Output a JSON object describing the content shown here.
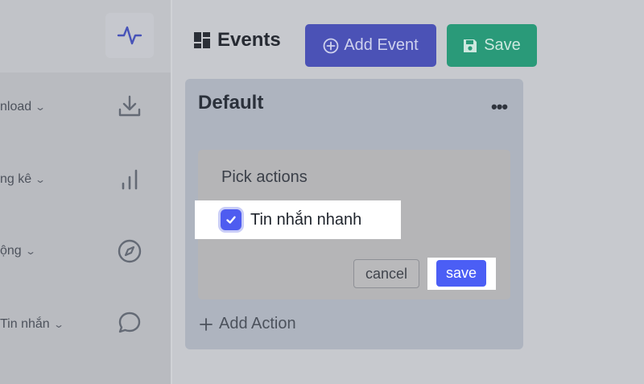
{
  "sidebar": {
    "items": [
      {
        "label": "nload",
        "icon": "download-icon"
      },
      {
        "label": "ng kê",
        "icon": "bar-chart-icon"
      },
      {
        "label": "ộng",
        "icon": "compass-icon"
      },
      {
        "label": "Tin nhắn",
        "icon": "message-icon"
      }
    ],
    "top_icon": "activity-icon"
  },
  "header": {
    "title": "Events",
    "add_event_label": "Add Event",
    "save_label": "Save"
  },
  "event_card": {
    "title": "Default",
    "more": "•••",
    "add_action_label": "Add Action"
  },
  "picker": {
    "title": "Pick actions",
    "option_label": "Tin nhắn nhanh",
    "option_checked": true,
    "cancel_label": "cancel",
    "save_label": "save"
  },
  "colors": {
    "accent_indigo": "#4b5ef5",
    "save_green": "#2a9a79"
  }
}
